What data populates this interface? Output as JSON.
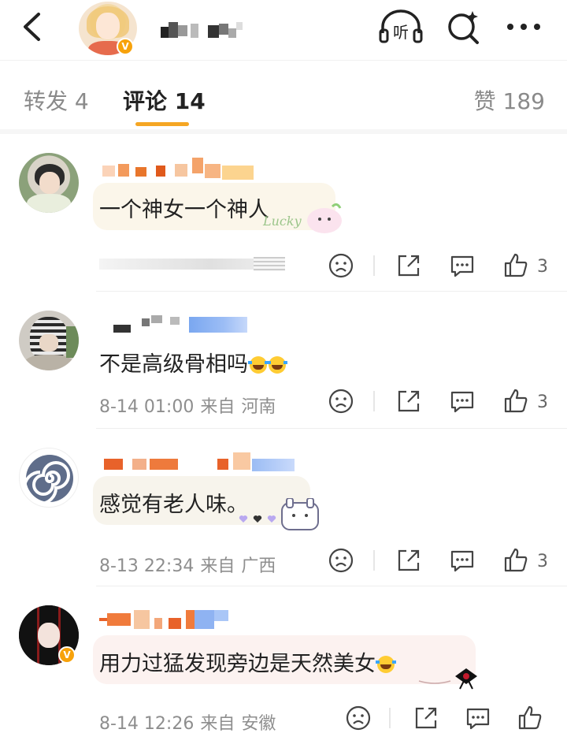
{
  "header": {
    "back_icon": "chevron-left-icon",
    "listen_label": "听",
    "verify_mark": "V",
    "icons": [
      "listen-icon",
      "search-sparkle-icon",
      "more-icon"
    ]
  },
  "tabs": {
    "repost": "转发 4",
    "comments": "评论 14",
    "likes": "赞 189"
  },
  "comments": [
    {
      "text": "一个神女一个神人",
      "sticker_text": "Lucky",
      "meta_time": "",
      "meta_source": "",
      "meta_region": "",
      "likes": "3"
    },
    {
      "text": "不是高级骨相吗",
      "meta_time": "8-14 01:00",
      "meta_source": "来自",
      "meta_region": "河南",
      "likes": "3"
    },
    {
      "text": "感觉有老人味。",
      "meta_time": "8-13 22:34",
      "meta_source": "来自",
      "meta_region": "广西",
      "likes": "3"
    },
    {
      "text": "用力过猛发现旁边是天然美女",
      "meta_time": "8-14 12:26",
      "meta_source": "来自",
      "meta_region": "安徽",
      "verify_mark": "V",
      "likes": ""
    }
  ],
  "colors": {
    "accent": "#f5a623",
    "verify": "#f7a20b",
    "text_primary": "#222222",
    "text_secondary": "#8e8e8e"
  }
}
